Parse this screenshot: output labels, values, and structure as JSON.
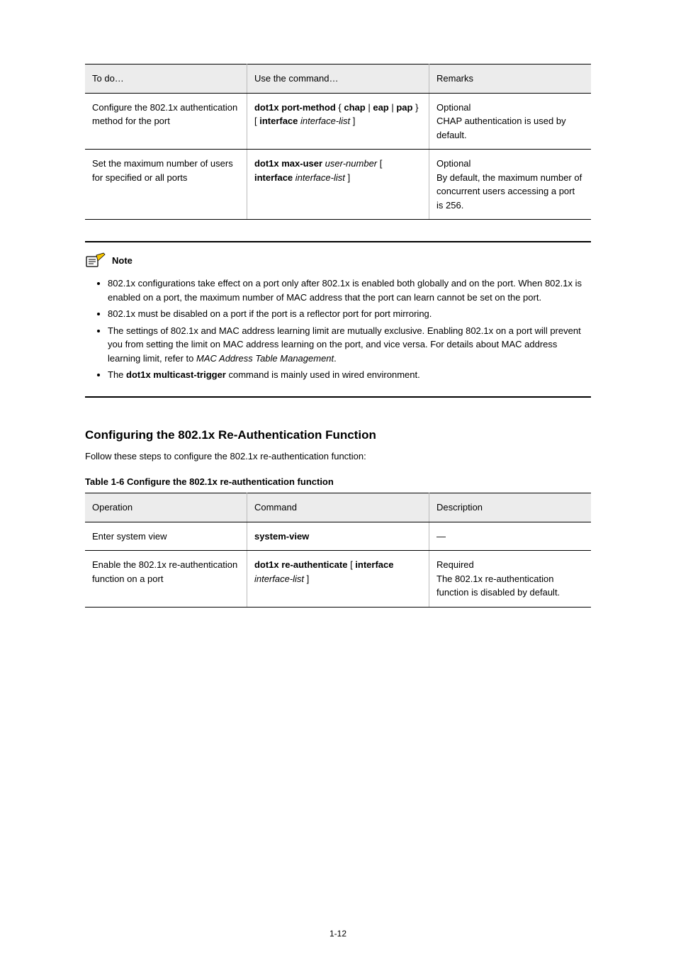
{
  "table1": {
    "headers": {
      "c1": "To do…",
      "c2": "Use the command…",
      "c3": "Remarks"
    },
    "row1": {
      "c1": "Configure the 802.1x authentication method for the port",
      "c2": "dot1x port-method { chap | eap | pap } [ interface interface-list ]",
      "c2_parts": [
        "dot1x port-method ",
        "{ ",
        "chap ",
        "| ",
        "eap ",
        "| ",
        "pap ",
        "} [ ",
        "interface ",
        "interface-list ",
        "]"
      ],
      "c3_line1": "Optional",
      "c3_line2": "CHAP authentication is used by default."
    },
    "row2": {
      "c1": "Set the maximum number of users for specified or all ports",
      "c2_parts": [
        "dot1x max-user ",
        "user-number ",
        "[ ",
        "interface ",
        "interface-list ",
        "]"
      ],
      "c3_line1": "Optional",
      "c3_line2": "By default, the maximum number of concurrent users accessing a port is 256."
    }
  },
  "note": {
    "label": "Note",
    "items": [
      "802.1x configurations take effect on a port only after 802.1x is enabled both globally and on the port. When 802.1x is enabled on a port, the maximum number of MAC address that the port can learn cannot be set on the port.",
      "802.1x must be disabled on a port if the port is a reflector port for port mirroring.",
      {
        "prefix": "The settings of 802.1x and MAC address learning limit are mutually exclusive. Enabling 802.1x on a port will prevent you from setting the limit on MAC address learning on the port, and vice versa. For details about MAC address learning limit, refer to ",
        "em": "MAC Address Table Management",
        "suffix": "."
      },
      {
        "prefix": "The ",
        "kw": "dot1x multicast-trigger",
        "suffix": " command is mainly used in wired environment."
      }
    ]
  },
  "section": {
    "heading": "Configuring the 802.1x Re-Authentication Function",
    "lead": "Follow these steps to configure the 802.1x re-authentication function:",
    "caption": "Table 1-6 Configure the 802.1x re-authentication function"
  },
  "table2": {
    "headers": {
      "c1": "Operation",
      "c2": "Command",
      "c3": "Description"
    },
    "row1": {
      "c1": "Enter system view",
      "c2": "system-view",
      "c3": "—"
    },
    "row2": {
      "c1": "Enable the 802.1x re-authentication function on a port",
      "c2_parts": [
        "dot1x re-authenticate ",
        "[ ",
        "interface ",
        "interface-list ",
        "]"
      ],
      "c3_line1": "Required",
      "c3_line2": "The 802.1x re-authentication function is disabled by default."
    }
  },
  "page_number": "1-12"
}
